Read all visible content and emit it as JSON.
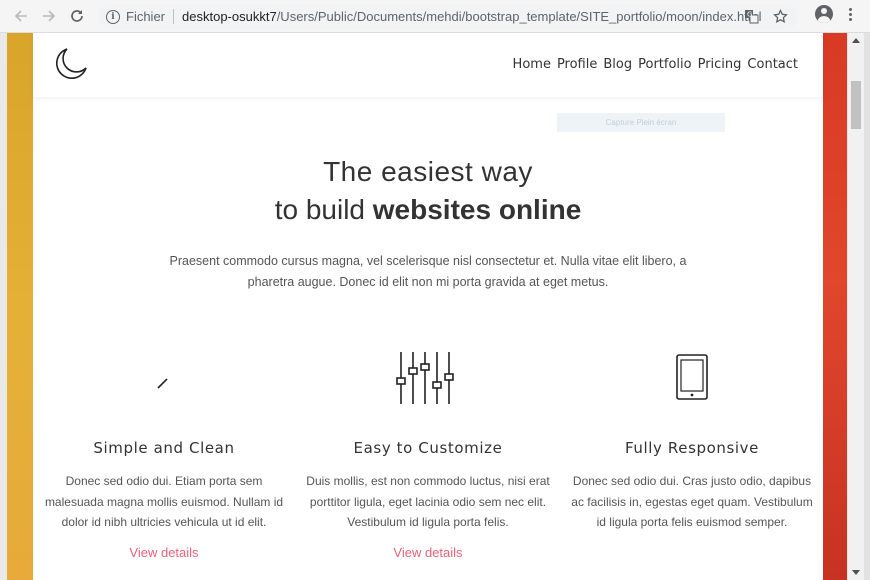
{
  "browser": {
    "back_icon": "arrow-left-icon",
    "forward_icon": "arrow-right-icon",
    "reload_icon": "reload-icon",
    "scheme_label": "Fichier",
    "url_host": "desktop-osukkt7",
    "url_path": "/Users/Public/Documents/mehdi/bootstrap_template/SITE_portfolio/moon/index.html",
    "translate_icon": "translate-icon",
    "bookmark_icon": "star-icon",
    "account_icon": "account-icon",
    "menu_icon": "kebab-menu-icon"
  },
  "site": {
    "logo_icon": "moon-icon",
    "nav": [
      "Home",
      "Profile",
      "Blog",
      "Portfolio",
      "Pricing",
      "Contact"
    ],
    "capture_tag": "Capture Plein écran"
  },
  "hero": {
    "line1": "The easiest way",
    "line2_prefix": "to build ",
    "line2_bold": "websites online",
    "text": "Praesent commodo cursus magna, vel scelerisque nisl consectetur et. Nulla vitae elit libero, a pharetra augue. Donec id elit non mi porta gravida at eget metus."
  },
  "features": [
    {
      "icon": "brush-icon",
      "title": "Simple and Clean",
      "text": "Donec sed odio dui. Etiam porta sem malesuada magna mollis euismod. Nullam id dolor id nibh ultricies vehicula ut id elit.",
      "link": "View details"
    },
    {
      "icon": "sliders-icon",
      "title": "Easy to Customize",
      "text": "Duis mollis, est non commodo luctus, nisi erat porttitor ligula, eget lacinia odio sem nec elit. Vestibulum id ligula porta felis.",
      "link": "View details"
    },
    {
      "icon": "tablet-icon",
      "title": "Fully Responsive",
      "text": "Donec sed odio dui. Cras justo odio, dapibus ac facilisis in, egestas eget quam. Vestibulum id ligula porta felis euismod semper.",
      "link": ""
    }
  ],
  "colors": {
    "link_color": "#f05f7a",
    "left_strip": "#e4b136",
    "right_strip": "#e0472c"
  }
}
